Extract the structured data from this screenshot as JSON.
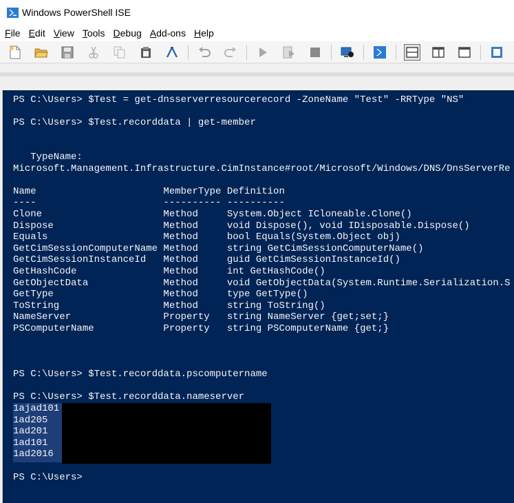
{
  "window": {
    "title": "Windows PowerShell ISE"
  },
  "menu": {
    "items": [
      {
        "label": "File",
        "accel": "F",
        "rest": "ile"
      },
      {
        "label": "Edit",
        "accel": "E",
        "rest": "dit"
      },
      {
        "label": "View",
        "accel": "V",
        "rest": "iew"
      },
      {
        "label": "Tools",
        "accel": "T",
        "rest": "ools"
      },
      {
        "label": "Debug",
        "accel": "D",
        "rest": "ebug"
      },
      {
        "label": "Add-ons",
        "accel": "A",
        "rest": "dd-ons"
      },
      {
        "label": "Help",
        "accel": "H",
        "rest": "elp"
      }
    ]
  },
  "toolbar": {
    "buttons": [
      "new-script-icon",
      "open-folder-icon",
      "save-icon",
      "cut-icon",
      "copy-icon",
      "paste-icon",
      "clear-console-icon",
      "undo-icon",
      "redo-icon",
      "run-script-icon",
      "run-selection-icon",
      "stop-icon",
      "new-remote-tab-icon",
      "powershell-console-icon",
      "show-script-pane-top-icon",
      "show-script-pane-right-icon",
      "show-script-pane-maximized-icon",
      "command-addon-icon"
    ]
  },
  "console": {
    "background": "#012456",
    "foreground": "#f5f5f5",
    "lines": [
      "PS C:\\Users> $Test = get-dnsserverresourcerecord -ZoneName \"Test\" -RRType \"NS\"",
      "",
      "PS C:\\Users> $Test.recorddata | get-member",
      "",
      "",
      "   TypeName:",
      "Microsoft.Management.Infrastructure.CimInstance#root/Microsoft/Windows/DNS/DnsServerRe",
      "",
      "Name                      MemberType Definition",
      "----                      ---------- ----------",
      "Clone                     Method     System.Object ICloneable.Clone()",
      "Dispose                   Method     void Dispose(), void IDisposable.Dispose()",
      "Equals                    Method     bool Equals(System.Object obj)",
      "GetCimSessionComputerName Method     string GetCimSessionComputerName()",
      "GetCimSessionInstanceId   Method     guid GetCimSessionInstanceId()",
      "GetHashCode               Method     int GetHashCode()",
      "GetObjectData             Method     void GetObjectData(System.Runtime.Serialization.S",
      "GetType                   Method     type GetType()",
      "ToString                  Method     string ToString()",
      "NameServer                Property   string NameServer {get;set;}",
      "PSComputerName            Property   string PSComputerName {get;}",
      "",
      "",
      "",
      "PS C:\\Users> $Test.recorddata.pscomputername",
      "",
      "PS C:\\Users> $Test.recorddata.nameserver",
      "1ajad101",
      "1ad205",
      "1ad201",
      "1ad101",
      "1ad2016",
      "",
      "PS C:\\Users>"
    ]
  }
}
